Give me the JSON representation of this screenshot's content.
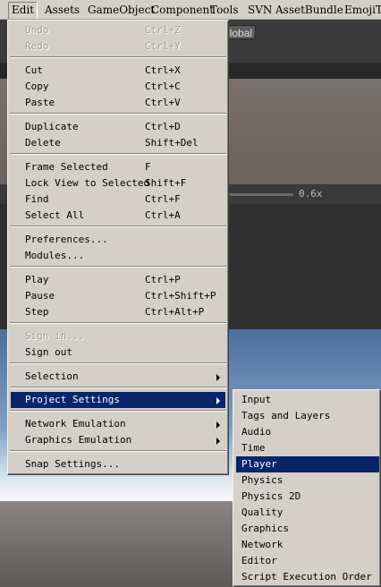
{
  "menubar": {
    "items": [
      {
        "label": "Edit"
      },
      {
        "label": "Assets"
      },
      {
        "label": "GameObject"
      },
      {
        "label": "Component"
      },
      {
        "label": "Tools"
      },
      {
        "label": "SVN"
      },
      {
        "label": "AssetBundle"
      },
      {
        "label": "EmojiTe"
      }
    ]
  },
  "background": {
    "global_button": "Global",
    "zoom_value": "0.6x"
  },
  "edit_menu": {
    "undo": {
      "label": "Undo",
      "shortcut": "Ctrl+Z"
    },
    "redo": {
      "label": "Redo",
      "shortcut": "Ctrl+Y"
    },
    "cut": {
      "label": "Cut",
      "shortcut": "Ctrl+X"
    },
    "copy": {
      "label": "Copy",
      "shortcut": "Ctrl+C"
    },
    "paste": {
      "label": "Paste",
      "shortcut": "Ctrl+V"
    },
    "duplicate": {
      "label": "Duplicate",
      "shortcut": "Ctrl+D"
    },
    "delete": {
      "label": "Delete",
      "shortcut": "Shift+Del"
    },
    "frame_selected": {
      "label": "Frame Selected",
      "shortcut": "F"
    },
    "lock_view": {
      "label": "Lock View to Selected",
      "shortcut": "Shift+F"
    },
    "find": {
      "label": "Find",
      "shortcut": "Ctrl+F"
    },
    "select_all": {
      "label": "Select All",
      "shortcut": "Ctrl+A"
    },
    "preferences": {
      "label": "Preferences..."
    },
    "modules": {
      "label": "Modules..."
    },
    "play": {
      "label": "Play",
      "shortcut": "Ctrl+P"
    },
    "pause": {
      "label": "Pause",
      "shortcut": "Ctrl+Shift+P"
    },
    "step": {
      "label": "Step",
      "shortcut": "Ctrl+Alt+P"
    },
    "sign_in": {
      "label": "Sign in..."
    },
    "sign_out": {
      "label": "Sign out"
    },
    "selection": {
      "label": "Selection"
    },
    "project_settings": {
      "label": "Project Settings"
    },
    "network_emulation": {
      "label": "Network Emulation"
    },
    "graphics_emulation": {
      "label": "Graphics Emulation"
    },
    "snap_settings": {
      "label": "Snap Settings..."
    }
  },
  "project_settings_menu": {
    "items": [
      {
        "label": "Input"
      },
      {
        "label": "Tags and Layers"
      },
      {
        "label": "Audio"
      },
      {
        "label": "Time"
      },
      {
        "label": "Player"
      },
      {
        "label": "Physics"
      },
      {
        "label": "Physics 2D"
      },
      {
        "label": "Quality"
      },
      {
        "label": "Graphics"
      },
      {
        "label": "Network"
      },
      {
        "label": "Editor"
      },
      {
        "label": "Script Execution Order"
      }
    ],
    "highlighted": "Player"
  },
  "colors": {
    "menu_bg": "#d4d0c8",
    "highlight": "#0a246a",
    "disabled_text": "#a0a0a0"
  }
}
